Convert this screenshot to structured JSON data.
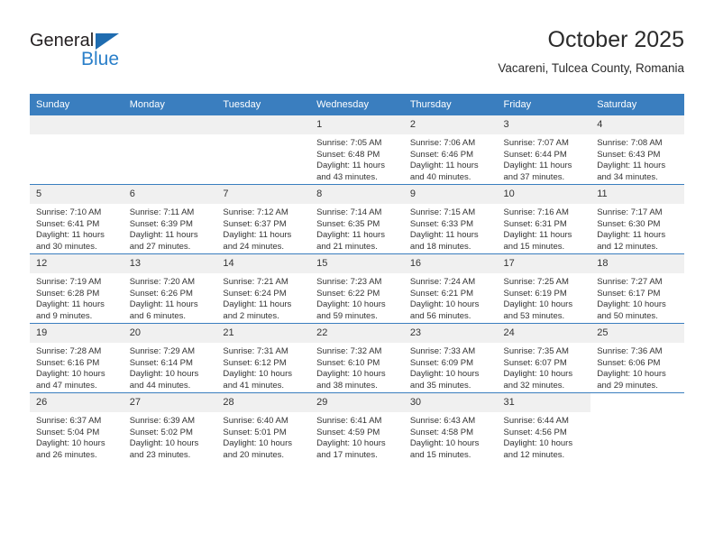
{
  "brand": {
    "name_top": "General",
    "name_bottom": "Blue",
    "triangle_icon": "triangle-icon",
    "color_dark": "#231f20",
    "color_blue": "#2a7fc9"
  },
  "header": {
    "title": "October 2025",
    "subtitle": "Vacareni, Tulcea County, Romania"
  },
  "theme": {
    "header_bg": "#3a7ebf",
    "daynum_bg": "#f0f0f0",
    "grid_line": "#3a7ebf",
    "text": "#333333"
  },
  "weekdays": [
    "Sunday",
    "Monday",
    "Tuesday",
    "Wednesday",
    "Thursday",
    "Friday",
    "Saturday"
  ],
  "labels": {
    "sunrise_prefix": "Sunrise:",
    "sunset_prefix": "Sunset:",
    "daylight_prefix": "Daylight:"
  },
  "weeks": [
    [
      {
        "day": "",
        "empty": true,
        "shaded": true
      },
      {
        "day": "",
        "empty": true,
        "shaded": true
      },
      {
        "day": "",
        "empty": true,
        "shaded": true
      },
      {
        "day": "1",
        "sunrise": "Sunrise: 7:05 AM",
        "sunset": "Sunset: 6:48 PM",
        "daylight1": "Daylight: 11 hours",
        "daylight2": "and 43 minutes."
      },
      {
        "day": "2",
        "sunrise": "Sunrise: 7:06 AM",
        "sunset": "Sunset: 6:46 PM",
        "daylight1": "Daylight: 11 hours",
        "daylight2": "and 40 minutes."
      },
      {
        "day": "3",
        "sunrise": "Sunrise: 7:07 AM",
        "sunset": "Sunset: 6:44 PM",
        "daylight1": "Daylight: 11 hours",
        "daylight2": "and 37 minutes."
      },
      {
        "day": "4",
        "sunrise": "Sunrise: 7:08 AM",
        "sunset": "Sunset: 6:43 PM",
        "daylight1": "Daylight: 11 hours",
        "daylight2": "and 34 minutes."
      }
    ],
    [
      {
        "day": "5",
        "sunrise": "Sunrise: 7:10 AM",
        "sunset": "Sunset: 6:41 PM",
        "daylight1": "Daylight: 11 hours",
        "daylight2": "and 30 minutes."
      },
      {
        "day": "6",
        "sunrise": "Sunrise: 7:11 AM",
        "sunset": "Sunset: 6:39 PM",
        "daylight1": "Daylight: 11 hours",
        "daylight2": "and 27 minutes."
      },
      {
        "day": "7",
        "sunrise": "Sunrise: 7:12 AM",
        "sunset": "Sunset: 6:37 PM",
        "daylight1": "Daylight: 11 hours",
        "daylight2": "and 24 minutes."
      },
      {
        "day": "8",
        "sunrise": "Sunrise: 7:14 AM",
        "sunset": "Sunset: 6:35 PM",
        "daylight1": "Daylight: 11 hours",
        "daylight2": "and 21 minutes."
      },
      {
        "day": "9",
        "sunrise": "Sunrise: 7:15 AM",
        "sunset": "Sunset: 6:33 PM",
        "daylight1": "Daylight: 11 hours",
        "daylight2": "and 18 minutes."
      },
      {
        "day": "10",
        "sunrise": "Sunrise: 7:16 AM",
        "sunset": "Sunset: 6:31 PM",
        "daylight1": "Daylight: 11 hours",
        "daylight2": "and 15 minutes."
      },
      {
        "day": "11",
        "sunrise": "Sunrise: 7:17 AM",
        "sunset": "Sunset: 6:30 PM",
        "daylight1": "Daylight: 11 hours",
        "daylight2": "and 12 minutes."
      }
    ],
    [
      {
        "day": "12",
        "sunrise": "Sunrise: 7:19 AM",
        "sunset": "Sunset: 6:28 PM",
        "daylight1": "Daylight: 11 hours",
        "daylight2": "and 9 minutes."
      },
      {
        "day": "13",
        "sunrise": "Sunrise: 7:20 AM",
        "sunset": "Sunset: 6:26 PM",
        "daylight1": "Daylight: 11 hours",
        "daylight2": "and 6 minutes."
      },
      {
        "day": "14",
        "sunrise": "Sunrise: 7:21 AM",
        "sunset": "Sunset: 6:24 PM",
        "daylight1": "Daylight: 11 hours",
        "daylight2": "and 2 minutes."
      },
      {
        "day": "15",
        "sunrise": "Sunrise: 7:23 AM",
        "sunset": "Sunset: 6:22 PM",
        "daylight1": "Daylight: 10 hours",
        "daylight2": "and 59 minutes."
      },
      {
        "day": "16",
        "sunrise": "Sunrise: 7:24 AM",
        "sunset": "Sunset: 6:21 PM",
        "daylight1": "Daylight: 10 hours",
        "daylight2": "and 56 minutes."
      },
      {
        "day": "17",
        "sunrise": "Sunrise: 7:25 AM",
        "sunset": "Sunset: 6:19 PM",
        "daylight1": "Daylight: 10 hours",
        "daylight2": "and 53 minutes."
      },
      {
        "day": "18",
        "sunrise": "Sunrise: 7:27 AM",
        "sunset": "Sunset: 6:17 PM",
        "daylight1": "Daylight: 10 hours",
        "daylight2": "and 50 minutes."
      }
    ],
    [
      {
        "day": "19",
        "sunrise": "Sunrise: 7:28 AM",
        "sunset": "Sunset: 6:16 PM",
        "daylight1": "Daylight: 10 hours",
        "daylight2": "and 47 minutes."
      },
      {
        "day": "20",
        "sunrise": "Sunrise: 7:29 AM",
        "sunset": "Sunset: 6:14 PM",
        "daylight1": "Daylight: 10 hours",
        "daylight2": "and 44 minutes."
      },
      {
        "day": "21",
        "sunrise": "Sunrise: 7:31 AM",
        "sunset": "Sunset: 6:12 PM",
        "daylight1": "Daylight: 10 hours",
        "daylight2": "and 41 minutes."
      },
      {
        "day": "22",
        "sunrise": "Sunrise: 7:32 AM",
        "sunset": "Sunset: 6:10 PM",
        "daylight1": "Daylight: 10 hours",
        "daylight2": "and 38 minutes."
      },
      {
        "day": "23",
        "sunrise": "Sunrise: 7:33 AM",
        "sunset": "Sunset: 6:09 PM",
        "daylight1": "Daylight: 10 hours",
        "daylight2": "and 35 minutes."
      },
      {
        "day": "24",
        "sunrise": "Sunrise: 7:35 AM",
        "sunset": "Sunset: 6:07 PM",
        "daylight1": "Daylight: 10 hours",
        "daylight2": "and 32 minutes."
      },
      {
        "day": "25",
        "sunrise": "Sunrise: 7:36 AM",
        "sunset": "Sunset: 6:06 PM",
        "daylight1": "Daylight: 10 hours",
        "daylight2": "and 29 minutes."
      }
    ],
    [
      {
        "day": "26",
        "sunrise": "Sunrise: 6:37 AM",
        "sunset": "Sunset: 5:04 PM",
        "daylight1": "Daylight: 10 hours",
        "daylight2": "and 26 minutes."
      },
      {
        "day": "27",
        "sunrise": "Sunrise: 6:39 AM",
        "sunset": "Sunset: 5:02 PM",
        "daylight1": "Daylight: 10 hours",
        "daylight2": "and 23 minutes."
      },
      {
        "day": "28",
        "sunrise": "Sunrise: 6:40 AM",
        "sunset": "Sunset: 5:01 PM",
        "daylight1": "Daylight: 10 hours",
        "daylight2": "and 20 minutes."
      },
      {
        "day": "29",
        "sunrise": "Sunrise: 6:41 AM",
        "sunset": "Sunset: 4:59 PM",
        "daylight1": "Daylight: 10 hours",
        "daylight2": "and 17 minutes."
      },
      {
        "day": "30",
        "sunrise": "Sunrise: 6:43 AM",
        "sunset": "Sunset: 4:58 PM",
        "daylight1": "Daylight: 10 hours",
        "daylight2": "and 15 minutes."
      },
      {
        "day": "31",
        "sunrise": "Sunrise: 6:44 AM",
        "sunset": "Sunset: 4:56 PM",
        "daylight1": "Daylight: 10 hours",
        "daylight2": "and 12 minutes."
      },
      {
        "day": "",
        "empty": true,
        "shaded": false
      }
    ]
  ]
}
